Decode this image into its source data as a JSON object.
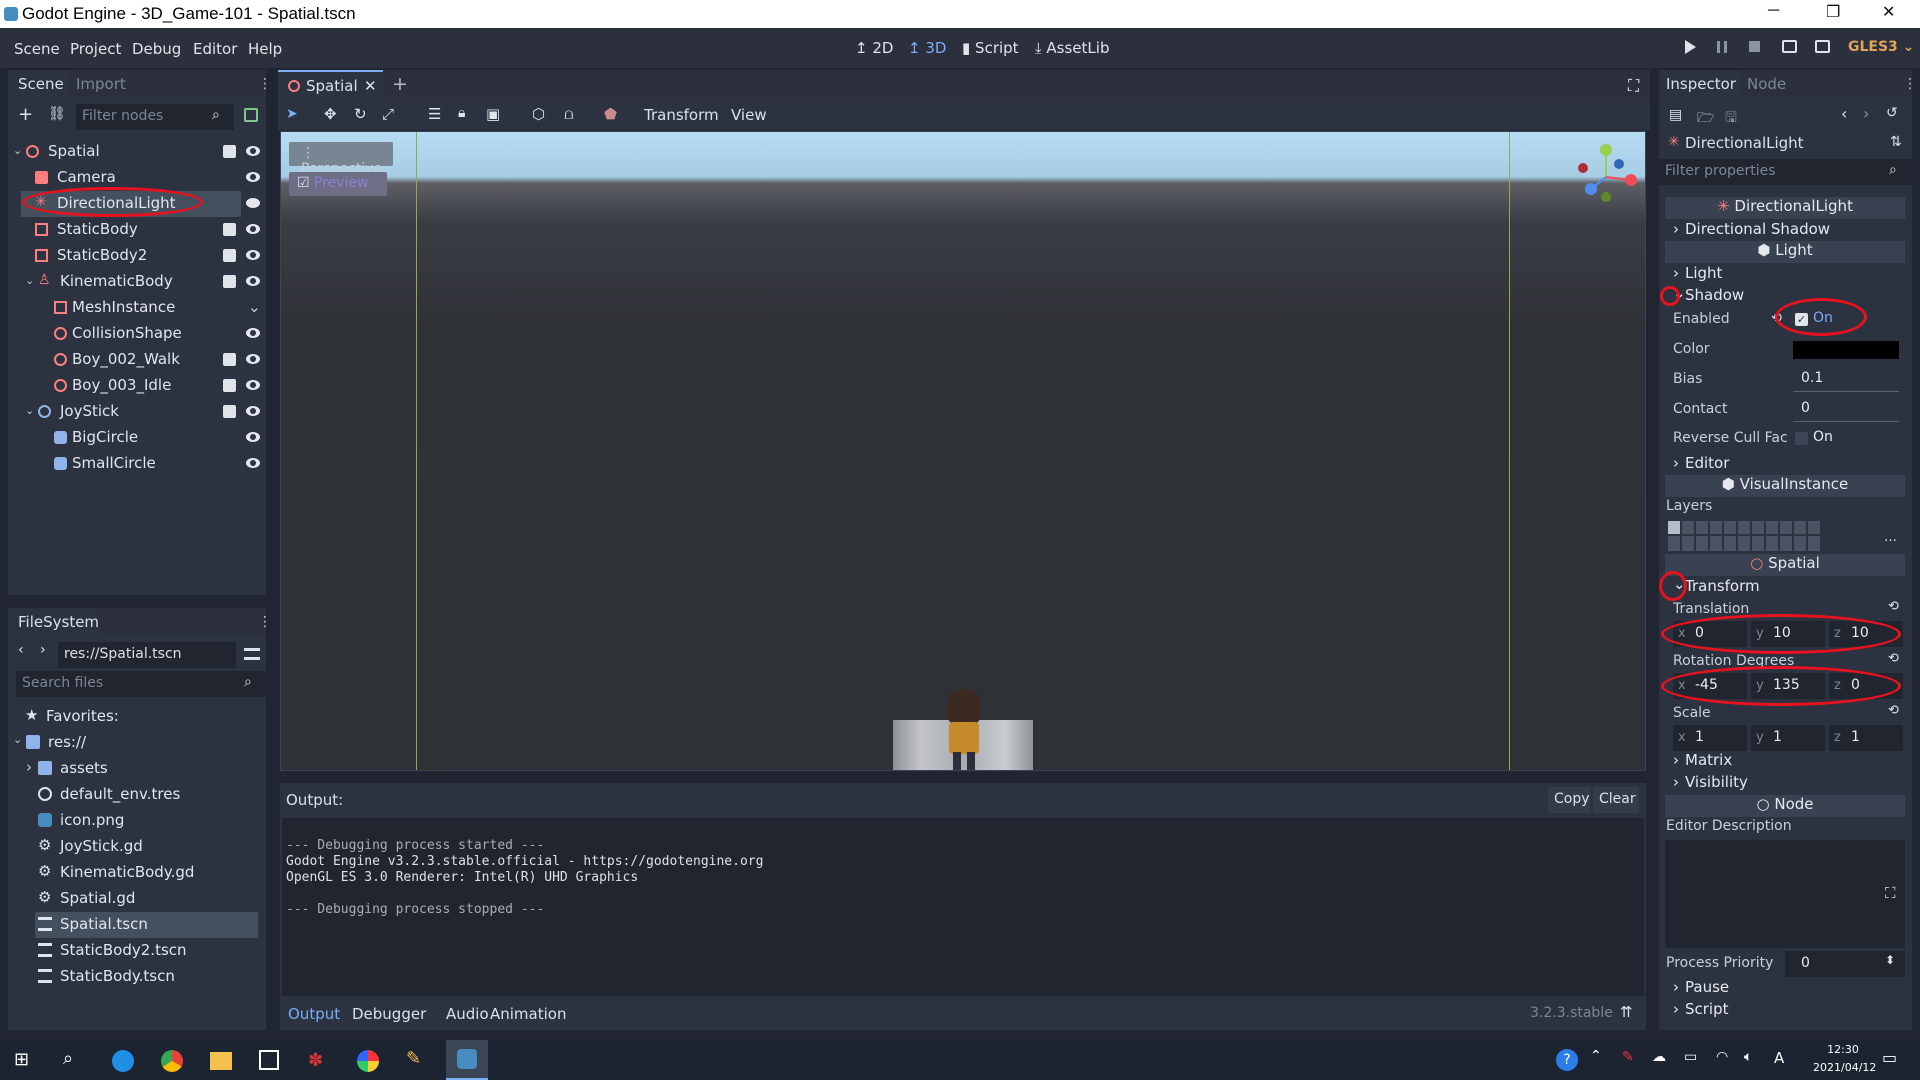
{
  "window": {
    "title": "Godot Engine - 3D_Game-101 - Spatial.tscn"
  },
  "menu": [
    "Scene",
    "Project",
    "Debug",
    "Editor",
    "Help"
  ],
  "workspaces": [
    {
      "label": "2D"
    },
    {
      "label": "3D"
    },
    {
      "label": "Script"
    },
    {
      "label": "AssetLib"
    }
  ],
  "renderer": "GLES3",
  "scene_dock": {
    "tabs": [
      "Scene",
      "Import"
    ],
    "filter_placeholder": "Filter nodes",
    "nodes": [
      {
        "name": "Spatial"
      },
      {
        "name": "Camera"
      },
      {
        "name": "DirectionalLight"
      },
      {
        "name": "StaticBody"
      },
      {
        "name": "StaticBody2"
      },
      {
        "name": "KinematicBody"
      },
      {
        "name": "MeshInstance"
      },
      {
        "name": "CollisionShape"
      },
      {
        "name": "Boy_002_Walk"
      },
      {
        "name": "Boy_003_Idle"
      },
      {
        "name": "JoyStick"
      },
      {
        "name": "BigCircle"
      },
      {
        "name": "SmallCircle"
      }
    ]
  },
  "filesystem": {
    "tab": "FileSystem",
    "path": "res://Spatial.tscn",
    "search_placeholder": "Search files",
    "items": [
      "Favorites:",
      "res://",
      "assets",
      "default_env.tres",
      "icon.png",
      "JoyStick.gd",
      "KinematicBody.gd",
      "Spatial.gd",
      "Spatial.tscn",
      "StaticBody2.tscn",
      "StaticBody.tscn"
    ]
  },
  "editor": {
    "tab": "Spatial",
    "menus": [
      "Transform",
      "View"
    ],
    "viewport_label": "Perspective",
    "preview_label": "Preview"
  },
  "output": {
    "label": "Output:",
    "copy": "Copy",
    "clear": "Clear",
    "lines": [
      "--- Debugging process started ---",
      "Godot Engine v3.2.3.stable.official - https://godotengine.org",
      "OpenGL ES 3.0 Renderer: Intel(R) UHD Graphics",
      "",
      "--- Debugging process stopped ---"
    ],
    "tabs": [
      "Output",
      "Debugger",
      "Audio",
      "Animation"
    ],
    "version": "3.2.3.stable"
  },
  "inspector": {
    "tabs": [
      "Inspector",
      "Node"
    ],
    "node_name": "DirectionalLight",
    "filter_placeholder": "Filter properties",
    "cls_directional": "DirectionalLight",
    "directional_shadow": "Directional Shadow",
    "cls_light": "Light",
    "light": "Light",
    "shadow": "Shadow",
    "enabled_label": "Enabled",
    "enabled_value": "On",
    "color_label": "Color",
    "bias_label": "Bias",
    "bias_value": "0.1",
    "contact_label": "Contact",
    "contact_value": "0",
    "reverse_cull_label": "Reverse Cull Fac",
    "reverse_cull_value": "On",
    "editor": "Editor",
    "cls_visual": "VisualInstance",
    "layers_label": "Layers",
    "cls_spatial": "Spatial",
    "transform": "Transform",
    "translation_label": "Translation",
    "translation": {
      "x": "0",
      "y": "10",
      "z": "10"
    },
    "rotation_label": "Rotation Degrees",
    "rotation": {
      "x": "-45",
      "y": "135",
      "z": "0"
    },
    "scale_label": "Scale",
    "scale": {
      "x": "1",
      "y": "1",
      "z": "1"
    },
    "matrix": "Matrix",
    "visibility": "Visibility",
    "cls_node": "Node",
    "editor_description": "Editor Description",
    "process_priority_label": "Process Priority",
    "process_priority_value": "0",
    "pause": "Pause",
    "script": "Script"
  },
  "taskbar": {
    "time": "12:30",
    "date": "2021/04/12",
    "ime": "A"
  },
  "colors": {
    "accent": "#7aaef5",
    "annotation": "#e8121f",
    "selection": "#45505f",
    "sky_top": "#b5dcf2"
  }
}
